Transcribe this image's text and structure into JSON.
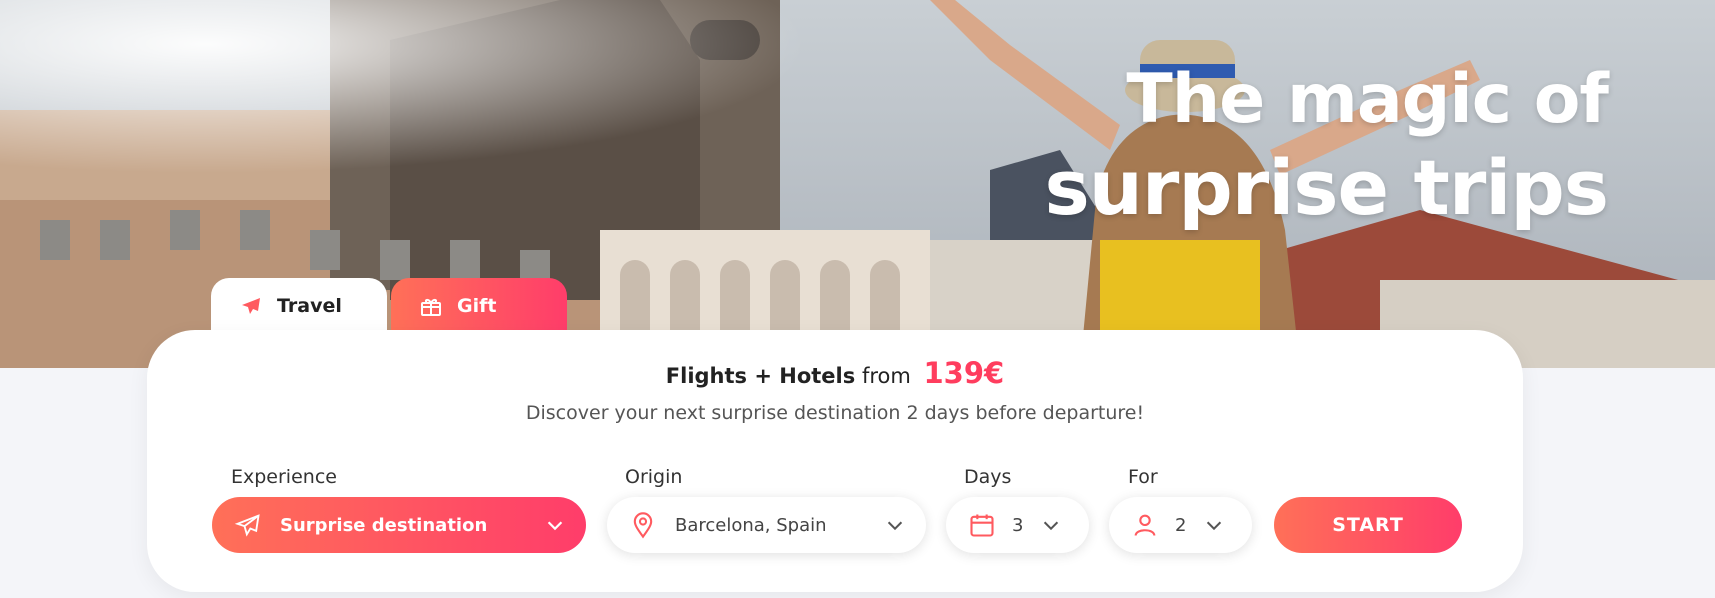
{
  "hero": {
    "title_line1": "The magic of",
    "title_line2": "surprise trips"
  },
  "tabs": [
    {
      "label": "Travel",
      "icon": "plane-icon",
      "active": true
    },
    {
      "label": "Gift",
      "icon": "gift-icon",
      "active": false
    }
  ],
  "card": {
    "headline_bold": "Flights + Hotels",
    "headline_from": "from",
    "price": "139€",
    "subline": "Discover your next surprise destination 2 days before departure!"
  },
  "form": {
    "experience": {
      "label": "Experience",
      "value": "Surprise destination",
      "icon": "plane-icon"
    },
    "origin": {
      "label": "Origin",
      "value": "Barcelona, Spain",
      "icon": "location-pin-icon"
    },
    "days": {
      "label": "Days",
      "value": "3",
      "icon": "calendar-icon"
    },
    "for": {
      "label": "For",
      "value": "2",
      "icon": "person-icon"
    },
    "start_label": "START"
  },
  "colors": {
    "accent_start": "#ff7058",
    "accent_end": "#ff3d6a",
    "price": "#ff3d5e"
  }
}
